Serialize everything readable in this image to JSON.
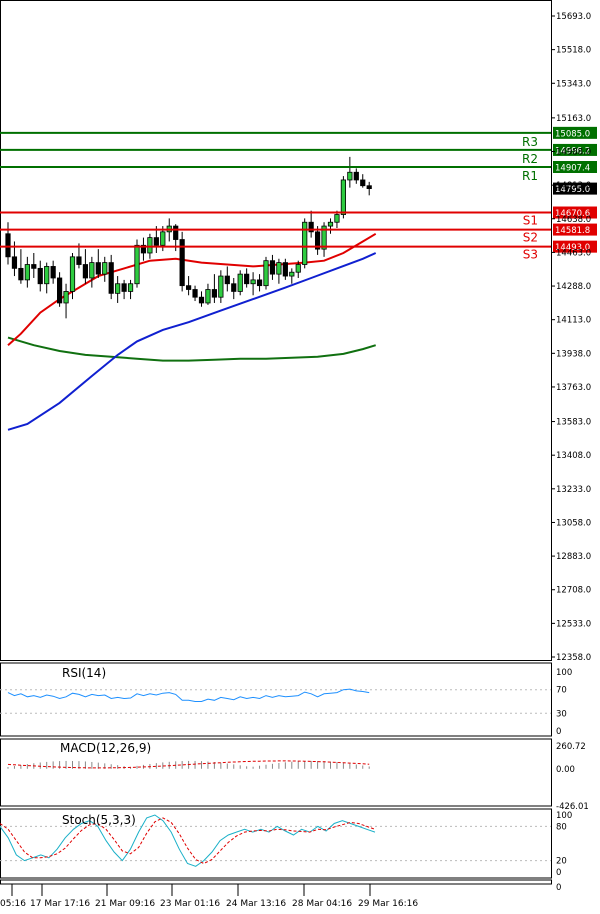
{
  "chart_data": {
    "type": "candlestick",
    "price_axis_ticks": [
      "15693.0",
      "15518.0",
      "15343.0",
      "15163.0",
      "14988.0",
      "14813.0",
      "14638.0",
      "14463.0",
      "14288.0",
      "14113.0",
      "13938.0",
      "13763.0",
      "13583.0",
      "13408.0",
      "13233.0",
      "13058.0",
      "12883.0",
      "12708.0",
      "12533.0",
      "12358.0"
    ],
    "price_range": [
      12358,
      15693
    ],
    "current_price": "14795.0",
    "levels": [
      {
        "name": "R3",
        "value": 15085.0,
        "label": "15085.0",
        "color": "#007000"
      },
      {
        "name": "R2",
        "value": 14996.2,
        "label": "14996.2",
        "color": "#007000"
      },
      {
        "name": "R1",
        "value": 14907.4,
        "label": "14907.4",
        "color": "#007000"
      },
      {
        "name": "S1",
        "value": 14670.6,
        "label": "14670.6",
        "color": "#e00000"
      },
      {
        "name": "S2",
        "value": 14581.8,
        "label": "14581.8",
        "color": "#e00000"
      },
      {
        "name": "S3",
        "value": 14493.0,
        "label": "14493.0",
        "color": "#e00000"
      }
    ],
    "x_labels": [
      "05:16",
      "17 Mar 17:16",
      "21 Mar 09:16",
      "23 Mar 01:16",
      "24 Mar 13:16",
      "28 Mar 04:16",
      "29 Mar 16:16"
    ],
    "candles": [
      [
        14560,
        14620,
        14400,
        14440
      ],
      [
        14440,
        14520,
        14340,
        14380
      ],
      [
        14380,
        14480,
        14300,
        14320
      ],
      [
        14320,
        14440,
        14280,
        14400
      ],
      [
        14400,
        14460,
        14330,
        14380
      ],
      [
        14380,
        14420,
        14260,
        14300
      ],
      [
        14300,
        14410,
        14250,
        14390
      ],
      [
        14390,
        14420,
        14300,
        14330
      ],
      [
        14330,
        14360,
        14180,
        14200
      ],
      [
        14200,
        14300,
        14120,
        14260
      ],
      [
        14260,
        14460,
        14220,
        14440
      ],
      [
        14440,
        14510,
        14380,
        14400
      ],
      [
        14400,
        14480,
        14300,
        14330
      ],
      [
        14330,
        14440,
        14280,
        14410
      ],
      [
        14410,
        14480,
        14330,
        14350
      ],
      [
        14350,
        14440,
        14310,
        14410
      ],
      [
        14410,
        14450,
        14220,
        14250
      ],
      [
        14250,
        14340,
        14200,
        14300
      ],
      [
        14300,
        14320,
        14220,
        14260
      ],
      [
        14260,
        14320,
        14220,
        14300
      ],
      [
        14300,
        14530,
        14280,
        14500
      ],
      [
        14500,
        14540,
        14420,
        14460
      ],
      [
        14460,
        14560,
        14430,
        14540
      ],
      [
        14540,
        14600,
        14460,
        14500
      ],
      [
        14500,
        14600,
        14470,
        14570
      ],
      [
        14570,
        14640,
        14520,
        14600
      ],
      [
        14600,
        14610,
        14470,
        14530
      ],
      [
        14530,
        14570,
        14260,
        14290
      ],
      [
        14290,
        14340,
        14240,
        14270
      ],
      [
        14270,
        14290,
        14210,
        14230
      ],
      [
        14230,
        14260,
        14180,
        14200
      ],
      [
        14200,
        14300,
        14190,
        14270
      ],
      [
        14270,
        14350,
        14200,
        14230
      ],
      [
        14230,
        14370,
        14200,
        14340
      ],
      [
        14340,
        14390,
        14260,
        14300
      ],
      [
        14300,
        14330,
        14220,
        14260
      ],
      [
        14260,
        14370,
        14240,
        14350
      ],
      [
        14350,
        14380,
        14280,
        14300
      ],
      [
        14300,
        14360,
        14240,
        14320
      ],
      [
        14320,
        14350,
        14260,
        14290
      ],
      [
        14290,
        14440,
        14270,
        14420
      ],
      [
        14420,
        14450,
        14320,
        14350
      ],
      [
        14350,
        14430,
        14300,
        14410
      ],
      [
        14410,
        14430,
        14320,
        14340
      ],
      [
        14340,
        14380,
        14300,
        14360
      ],
      [
        14360,
        14420,
        14330,
        14400
      ],
      [
        14400,
        14640,
        14380,
        14620
      ],
      [
        14620,
        14680,
        14540,
        14570
      ],
      [
        14570,
        14600,
        14450,
        14480
      ],
      [
        14480,
        14620,
        14440,
        14600
      ],
      [
        14600,
        14640,
        14560,
        14620
      ],
      [
        14620,
        14680,
        14590,
        14660
      ],
      [
        14660,
        14860,
        14640,
        14840
      ],
      [
        14840,
        14960,
        14800,
        14880
      ],
      [
        14880,
        14900,
        14820,
        14840
      ],
      [
        14840,
        14870,
        14800,
        14810
      ],
      [
        14810,
        14830,
        14760,
        14795
      ]
    ],
    "ma_red": [
      [
        0,
        13980
      ],
      [
        2,
        14040
      ],
      [
        5,
        14150
      ],
      [
        8,
        14220
      ],
      [
        11,
        14280
      ],
      [
        14,
        14340
      ],
      [
        18,
        14380
      ],
      [
        22,
        14420
      ],
      [
        26,
        14430
      ],
      [
        30,
        14410
      ],
      [
        34,
        14400
      ],
      [
        38,
        14390
      ],
      [
        42,
        14400
      ],
      [
        46,
        14410
      ],
      [
        49,
        14420
      ],
      [
        52,
        14460
      ],
      [
        55,
        14520
      ],
      [
        57,
        14560
      ]
    ],
    "ma_blue": [
      [
        0,
        13540
      ],
      [
        3,
        13570
      ],
      [
        8,
        13680
      ],
      [
        13,
        13820
      ],
      [
        17,
        13930
      ],
      [
        20,
        14000
      ],
      [
        24,
        14060
      ],
      [
        28,
        14100
      ],
      [
        33,
        14160
      ],
      [
        38,
        14220
      ],
      [
        43,
        14280
      ],
      [
        47,
        14330
      ],
      [
        51,
        14380
      ],
      [
        55,
        14430
      ],
      [
        57,
        14460
      ]
    ],
    "ma_green": [
      [
        0,
        14020
      ],
      [
        4,
        13980
      ],
      [
        8,
        13950
      ],
      [
        12,
        13930
      ],
      [
        16,
        13920
      ],
      [
        20,
        13910
      ],
      [
        24,
        13900
      ],
      [
        28,
        13900
      ],
      [
        32,
        13905
      ],
      [
        36,
        13910
      ],
      [
        40,
        13910
      ],
      [
        44,
        13915
      ],
      [
        48,
        13920
      ],
      [
        52,
        13935
      ],
      [
        55,
        13960
      ],
      [
        57,
        13980
      ]
    ],
    "rsi": {
      "label": "RSI(14)",
      "ticks": [
        "100",
        "70",
        "30",
        "0"
      ],
      "range": [
        0,
        100
      ],
      "values": [
        65,
        60,
        63,
        58,
        60,
        57,
        61,
        59,
        55,
        58,
        64,
        62,
        58,
        62,
        60,
        61,
        55,
        57,
        55,
        56,
        63,
        60,
        63,
        61,
        64,
        65,
        62,
        52,
        52,
        50,
        50,
        54,
        52,
        57,
        55,
        53,
        58,
        55,
        57,
        55,
        60,
        57,
        60,
        58,
        59,
        60,
        66,
        63,
        58,
        63,
        64,
        65,
        70,
        71,
        68,
        67,
        65
      ]
    },
    "macd": {
      "label": "MACD(12,26,9)",
      "ticks": [
        "260.72",
        "0.00",
        "-426.01"
      ],
      "range": [
        -426.01,
        260.72
      ]
    },
    "stoch": {
      "label": "Stoch(5,3,3)",
      "ticks": [
        "100",
        "80",
        "20",
        "0"
      ],
      "range": [
        0,
        100
      ],
      "k": [
        80,
        60,
        30,
        20,
        25,
        30,
        25,
        40,
        60,
        75,
        85,
        90,
        80,
        55,
        35,
        20,
        40,
        70,
        95,
        100,
        90,
        70,
        40,
        15,
        10,
        20,
        35,
        55,
        65,
        70,
        75,
        70,
        75,
        70,
        80,
        72,
        65,
        75,
        70,
        80,
        72,
        85,
        90,
        85,
        80,
        75,
        70
      ],
      "d": [
        85,
        75,
        55,
        35,
        25,
        25,
        27,
        32,
        42,
        58,
        73,
        83,
        85,
        75,
        57,
        37,
        32,
        43,
        68,
        88,
        95,
        87,
        67,
        42,
        22,
        15,
        22,
        37,
        52,
        63,
        70,
        72,
        73,
        72,
        75,
        74,
        72,
        71,
        70,
        75,
        74,
        79,
        83,
        87,
        85,
        80,
        75
      ]
    }
  }
}
